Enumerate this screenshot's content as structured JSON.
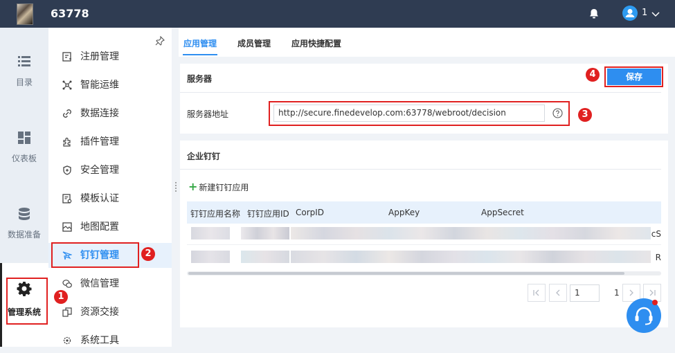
{
  "header": {
    "app_title": "63778",
    "user_name": "1",
    "bell_icon": "bell-icon",
    "avatar_icon": "user-avatar-icon",
    "dropdown_icon": "chevron-down-icon"
  },
  "rail": {
    "items": [
      {
        "label": "目录",
        "icon": "list-icon"
      },
      {
        "label": "仪表板",
        "icon": "dashboard-icon"
      },
      {
        "label": "数据准备",
        "icon": "database-icon"
      },
      {
        "label": "管理系统",
        "icon": "gear-icon",
        "active": true
      }
    ]
  },
  "menu": {
    "items": [
      {
        "label": "注册管理",
        "icon": "register-icon"
      },
      {
        "label": "智能运维",
        "icon": "ops-icon"
      },
      {
        "label": "数据连接",
        "icon": "link-icon"
      },
      {
        "label": "插件管理",
        "icon": "plugin-icon"
      },
      {
        "label": "安全管理",
        "icon": "shield-icon"
      },
      {
        "label": "模板认证",
        "icon": "template-auth-icon"
      },
      {
        "label": "地图配置",
        "icon": "map-icon"
      },
      {
        "label": "钉钉管理",
        "icon": "dingtalk-icon",
        "active": true
      },
      {
        "label": "微信管理",
        "icon": "wechat-icon"
      },
      {
        "label": "资源交接",
        "icon": "resource-icon"
      },
      {
        "label": "系统工具",
        "icon": "tools-icon"
      }
    ]
  },
  "tabs": [
    "应用管理",
    "成员管理",
    "应用快捷配置"
  ],
  "server_panel": {
    "title": "服务器",
    "save_label": "保存",
    "address_label": "服务器地址",
    "address_value": "http://secure.finedevelop.com:63778/webroot/decision"
  },
  "dingtalk_panel": {
    "title": "企业钉钉",
    "add_label": "新建钉钉应用",
    "columns": [
      "钉钉应用名称",
      "钉钉应用ID",
      "CorpID",
      "AppKey",
      "AppSecret"
    ],
    "row_edges": [
      "cS",
      "R"
    ]
  },
  "pagination": {
    "current_page": "1",
    "total_pages": "1"
  },
  "annotations": [
    "1",
    "2",
    "3",
    "4"
  ],
  "colors": {
    "accent": "#2e8ef0",
    "topbar": "#2f3c52",
    "highlight_red": "#e02020"
  }
}
